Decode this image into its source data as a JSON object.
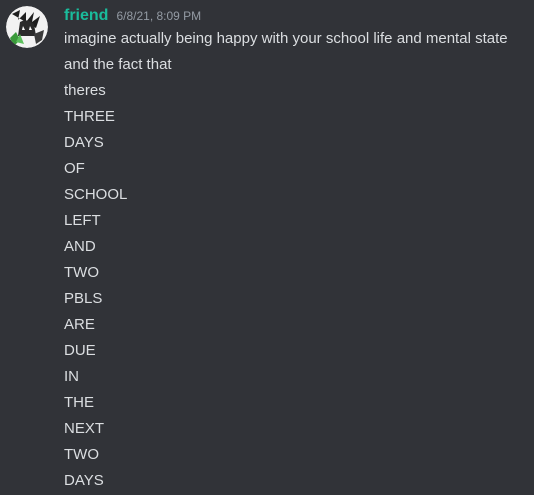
{
  "message": {
    "author": "friend",
    "timestamp": "6/8/21, 8:09 PM",
    "author_color": "#1abc9c",
    "avatar_icon": "anime-character-avatar-icon",
    "lines": [
      "imagine actually being happy with your school life and mental state",
      "and the fact that",
      "theres",
      "THREE",
      "DAYS",
      "OF",
      "SCHOOL",
      "LEFT",
      "AND",
      "TWO",
      "PBLS",
      "ARE",
      "DUE",
      "IN",
      "THE",
      "NEXT",
      "TWO",
      "DAYS"
    ]
  },
  "theme": {
    "background": "#313338",
    "text": "#dbdee1",
    "muted": "#949ba4"
  }
}
